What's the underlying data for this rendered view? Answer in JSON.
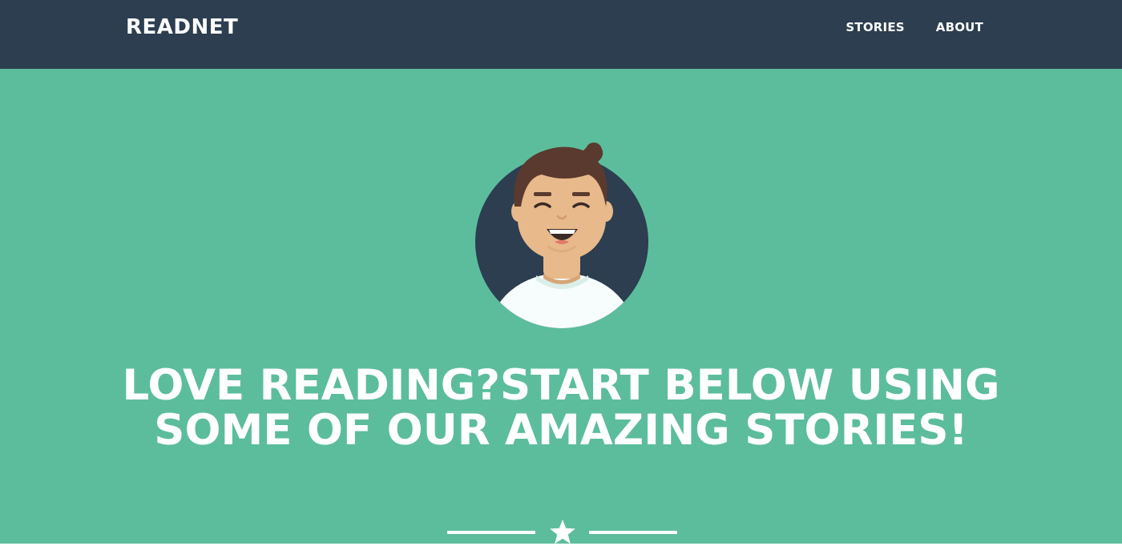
{
  "navbar": {
    "brand": "READNET",
    "links": [
      {
        "label": "STORIES"
      },
      {
        "label": "ABOUT"
      }
    ]
  },
  "masthead": {
    "avatar_icon": "smiling-person-avatar-icon",
    "headline": "LOVE READING?START BELOW USING SOME OF OUR AMAZING STORIES!",
    "divider_icon": "star-icon"
  },
  "colors": {
    "navbar": "#2c3e50",
    "masthead": "#5cbd9c",
    "text": "#ffffff",
    "avatar_bg": "#2c3e50",
    "skin": "#e8b98a",
    "hair": "#5a3a2e",
    "shirt": "#f7fcfd"
  }
}
